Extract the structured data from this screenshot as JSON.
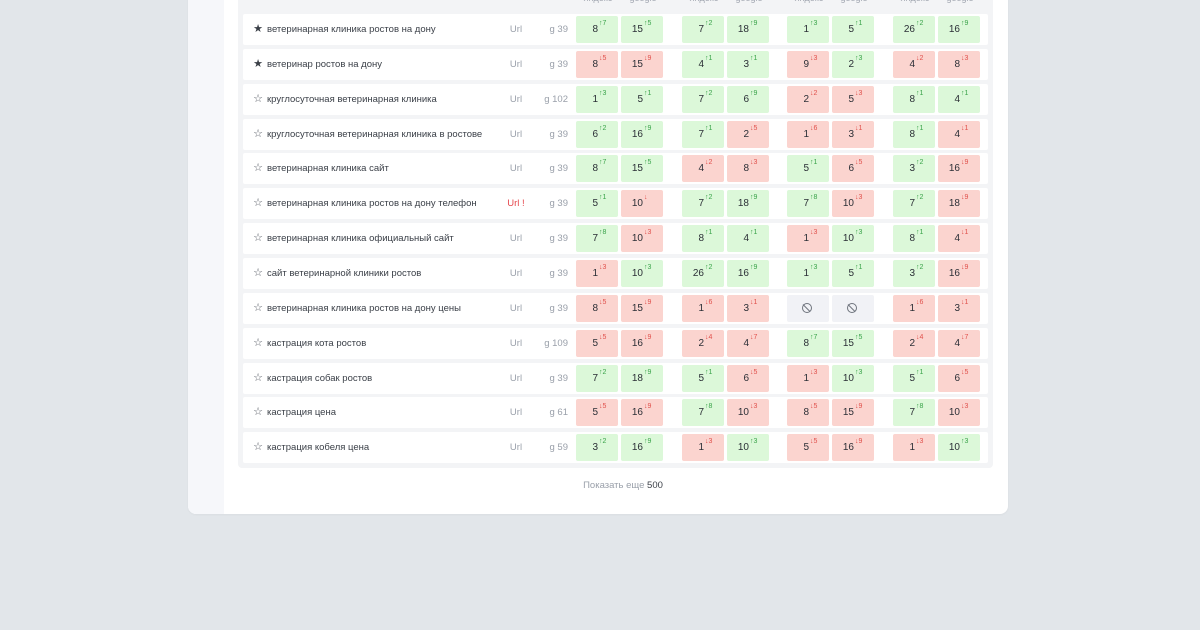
{
  "header": {
    "engines": [
      "яндекс",
      "google",
      "яндекс",
      "google",
      "яндекс",
      "google",
      "яндекс",
      "google"
    ]
  },
  "rows": [
    {
      "star": "filled",
      "keyword": "ветеринарная клиника ростов на дону",
      "url": "Url",
      "url_error": false,
      "geo": "g 39",
      "cells": [
        {
          "v": "8",
          "d": "↑7",
          "s": "up"
        },
        {
          "v": "15",
          "d": "↑5",
          "s": "up"
        },
        {
          "v": "7",
          "d": "↑2",
          "s": "up"
        },
        {
          "v": "18",
          "d": "↑9",
          "s": "up"
        },
        {
          "v": "1",
          "d": "↑3",
          "s": "up"
        },
        {
          "v": "5",
          "d": "↑1",
          "s": "up"
        },
        {
          "v": "26",
          "d": "↑2",
          "s": "up"
        },
        {
          "v": "16",
          "d": "↑9",
          "s": "up"
        }
      ]
    },
    {
      "star": "filled",
      "keyword": "ветеринар ростов на дону",
      "url": "Url",
      "url_error": false,
      "geo": "g 39",
      "cells": [
        {
          "v": "8",
          "d": "↓5",
          "s": "down"
        },
        {
          "v": "15",
          "d": "↓9",
          "s": "down"
        },
        {
          "v": "4",
          "d": "↑1",
          "s": "up"
        },
        {
          "v": "3",
          "d": "↑1",
          "s": "up"
        },
        {
          "v": "9",
          "d": "↓3",
          "s": "down"
        },
        {
          "v": "2",
          "d": "↑3",
          "s": "up"
        },
        {
          "v": "4",
          "d": "↓2",
          "s": "down"
        },
        {
          "v": "8",
          "d": "↓3",
          "s": "down"
        }
      ]
    },
    {
      "star": "empty",
      "keyword": "круглосуточная ветеринарная клиника",
      "url": "Url",
      "url_error": false,
      "geo": "g 102",
      "cells": [
        {
          "v": "1",
          "d": "↑3",
          "s": "up"
        },
        {
          "v": "5",
          "d": "↑1",
          "s": "up"
        },
        {
          "v": "7",
          "d": "↑2",
          "s": "up"
        },
        {
          "v": "6",
          "d": "↑9",
          "s": "up"
        },
        {
          "v": "2",
          "d": "↓2",
          "s": "down"
        },
        {
          "v": "5",
          "d": "↓3",
          "s": "down"
        },
        {
          "v": "8",
          "d": "↑1",
          "s": "up"
        },
        {
          "v": "4",
          "d": "↑1",
          "s": "up"
        }
      ]
    },
    {
      "star": "empty",
      "keyword": "круглосуточная ветеринарная клиника в ростове",
      "url": "Url",
      "url_error": false,
      "geo": "g 39",
      "cells": [
        {
          "v": "6",
          "d": "↑2",
          "s": "up"
        },
        {
          "v": "16",
          "d": "↑9",
          "s": "up"
        },
        {
          "v": "7",
          "d": "↑1",
          "s": "up"
        },
        {
          "v": "2",
          "d": "↓5",
          "s": "down"
        },
        {
          "v": "1",
          "d": "↓6",
          "s": "down"
        },
        {
          "v": "3",
          "d": "↓1",
          "s": "down"
        },
        {
          "v": "8",
          "d": "↑1",
          "s": "up"
        },
        {
          "v": "4",
          "d": "↓1",
          "s": "down"
        }
      ]
    },
    {
      "star": "empty",
      "keyword": "ветеринарная клиника сайт",
      "url": "Url",
      "url_error": false,
      "geo": "g 39",
      "cells": [
        {
          "v": "8",
          "d": "↑7",
          "s": "up"
        },
        {
          "v": "15",
          "d": "↑5",
          "s": "up"
        },
        {
          "v": "4",
          "d": "↓2",
          "s": "down"
        },
        {
          "v": "8",
          "d": "↓3",
          "s": "down"
        },
        {
          "v": "5",
          "d": "↑1",
          "s": "up"
        },
        {
          "v": "6",
          "d": "↓5",
          "s": "down"
        },
        {
          "v": "3",
          "d": "↑2",
          "s": "up"
        },
        {
          "v": "16",
          "d": "↓9",
          "s": "down"
        }
      ]
    },
    {
      "star": "empty",
      "keyword": "ветеринарная клиника ростов на дону телефон",
      "url": "Url !",
      "url_error": true,
      "geo": "g 39",
      "cells": [
        {
          "v": "5",
          "d": "↑1",
          "s": "up"
        },
        {
          "v": "10",
          "d": "↓",
          "s": "down"
        },
        {
          "v": "7",
          "d": "↑2",
          "s": "up"
        },
        {
          "v": "18",
          "d": "↑9",
          "s": "up"
        },
        {
          "v": "7",
          "d": "↑8",
          "s": "up"
        },
        {
          "v": "10",
          "d": "↓3",
          "s": "down"
        },
        {
          "v": "7",
          "d": "↑2",
          "s": "up"
        },
        {
          "v": "18",
          "d": "↓9",
          "s": "down"
        }
      ]
    },
    {
      "star": "empty",
      "keyword": "ветеринарная клиника официальный сайт",
      "url": "Url",
      "url_error": false,
      "geo": "g 39",
      "cells": [
        {
          "v": "7",
          "d": "↑8",
          "s": "up"
        },
        {
          "v": "10",
          "d": "↓3",
          "s": "down"
        },
        {
          "v": "8",
          "d": "↑1",
          "s": "up"
        },
        {
          "v": "4",
          "d": "↑1",
          "s": "up"
        },
        {
          "v": "1",
          "d": "↓3",
          "s": "down"
        },
        {
          "v": "10",
          "d": "↑3",
          "s": "up"
        },
        {
          "v": "8",
          "d": "↑1",
          "s": "up"
        },
        {
          "v": "4",
          "d": "↓1",
          "s": "down"
        }
      ]
    },
    {
      "star": "empty",
      "keyword": "сайт ветеринарной клиники ростов",
      "url": "Url",
      "url_error": false,
      "geo": "g 39",
      "cells": [
        {
          "v": "1",
          "d": "↓3",
          "s": "down"
        },
        {
          "v": "10",
          "d": "↑3",
          "s": "up"
        },
        {
          "v": "26",
          "d": "↑2",
          "s": "up"
        },
        {
          "v": "16",
          "d": "↑9",
          "s": "up"
        },
        {
          "v": "1",
          "d": "↑3",
          "s": "up"
        },
        {
          "v": "5",
          "d": "↑1",
          "s": "up"
        },
        {
          "v": "3",
          "d": "↑2",
          "s": "up"
        },
        {
          "v": "16",
          "d": "↓9",
          "s": "down"
        }
      ]
    },
    {
      "star": "empty",
      "keyword": "ветеринарная клиника ростов на дону цены",
      "url": "Url",
      "url_error": false,
      "geo": "g 39",
      "cells": [
        {
          "v": "8",
          "d": "↓5",
          "s": "down"
        },
        {
          "v": "15",
          "d": "↓9",
          "s": "down"
        },
        {
          "v": "1",
          "d": "↓6",
          "s": "down"
        },
        {
          "v": "3",
          "d": "↓1",
          "s": "down"
        },
        {
          "v": "",
          "d": "",
          "s": "none"
        },
        {
          "v": "",
          "d": "",
          "s": "none"
        },
        {
          "v": "1",
          "d": "↓6",
          "s": "down"
        },
        {
          "v": "3",
          "d": "↓1",
          "s": "down"
        }
      ]
    },
    {
      "star": "empty",
      "keyword": "кастрация кота ростов",
      "url": "Url",
      "url_error": false,
      "geo": "g 109",
      "cells": [
        {
          "v": "5",
          "d": "↓5",
          "s": "down"
        },
        {
          "v": "16",
          "d": "↓9",
          "s": "down"
        },
        {
          "v": "2",
          "d": "↓4",
          "s": "down"
        },
        {
          "v": "4",
          "d": "↓7",
          "s": "down"
        },
        {
          "v": "8",
          "d": "↑7",
          "s": "up"
        },
        {
          "v": "15",
          "d": "↑5",
          "s": "up"
        },
        {
          "v": "2",
          "d": "↓4",
          "s": "down"
        },
        {
          "v": "4",
          "d": "↓7",
          "s": "down"
        }
      ]
    },
    {
      "star": "empty",
      "keyword": "кастрация собак ростов",
      "url": "Url",
      "url_error": false,
      "geo": "g 39",
      "cells": [
        {
          "v": "7",
          "d": "↑2",
          "s": "up"
        },
        {
          "v": "18",
          "d": "↑9",
          "s": "up"
        },
        {
          "v": "5",
          "d": "↑1",
          "s": "up"
        },
        {
          "v": "6",
          "d": "↓5",
          "s": "down"
        },
        {
          "v": "1",
          "d": "↓3",
          "s": "down"
        },
        {
          "v": "10",
          "d": "↑3",
          "s": "up"
        },
        {
          "v": "5",
          "d": "↑1",
          "s": "up"
        },
        {
          "v": "6",
          "d": "↓5",
          "s": "down"
        }
      ]
    },
    {
      "star": "empty",
      "keyword": "кастрация цена",
      "url": "Url",
      "url_error": false,
      "geo": "g 61",
      "cells": [
        {
          "v": "5",
          "d": "↓5",
          "s": "down"
        },
        {
          "v": "16",
          "d": "↓9",
          "s": "down"
        },
        {
          "v": "7",
          "d": "↑8",
          "s": "up"
        },
        {
          "v": "10",
          "d": "↓3",
          "s": "down"
        },
        {
          "v": "8",
          "d": "↓5",
          "s": "down"
        },
        {
          "v": "15",
          "d": "↓9",
          "s": "down"
        },
        {
          "v": "7",
          "d": "↑8",
          "s": "up"
        },
        {
          "v": "10",
          "d": "↓3",
          "s": "down"
        }
      ]
    },
    {
      "star": "empty",
      "keyword": "кастрация кобеля цена",
      "url": "Url",
      "url_error": false,
      "geo": "g 59",
      "cells": [
        {
          "v": "3",
          "d": "↑2",
          "s": "up"
        },
        {
          "v": "16",
          "d": "↑9",
          "s": "up"
        },
        {
          "v": "1",
          "d": "↓3",
          "s": "down"
        },
        {
          "v": "10",
          "d": "↑3",
          "s": "up"
        },
        {
          "v": "5",
          "d": "↓5",
          "s": "down"
        },
        {
          "v": "16",
          "d": "↓9",
          "s": "down"
        },
        {
          "v": "1",
          "d": "↓3",
          "s": "down"
        },
        {
          "v": "10",
          "d": "↑3",
          "s": "up"
        }
      ]
    }
  ],
  "footer": {
    "show_more_label": "Показать еще",
    "show_more_count": "500"
  },
  "colors": {
    "up_bg": "#dcf8d9",
    "down_bg": "#fbd4cf",
    "up_text": "#3aa34a",
    "down_text": "#e0514c",
    "url_error": "#e5484d"
  },
  "icons": {
    "star_filled": "star-filled-icon",
    "star_empty": "star-outline-icon",
    "no_data": "no-data-icon"
  }
}
